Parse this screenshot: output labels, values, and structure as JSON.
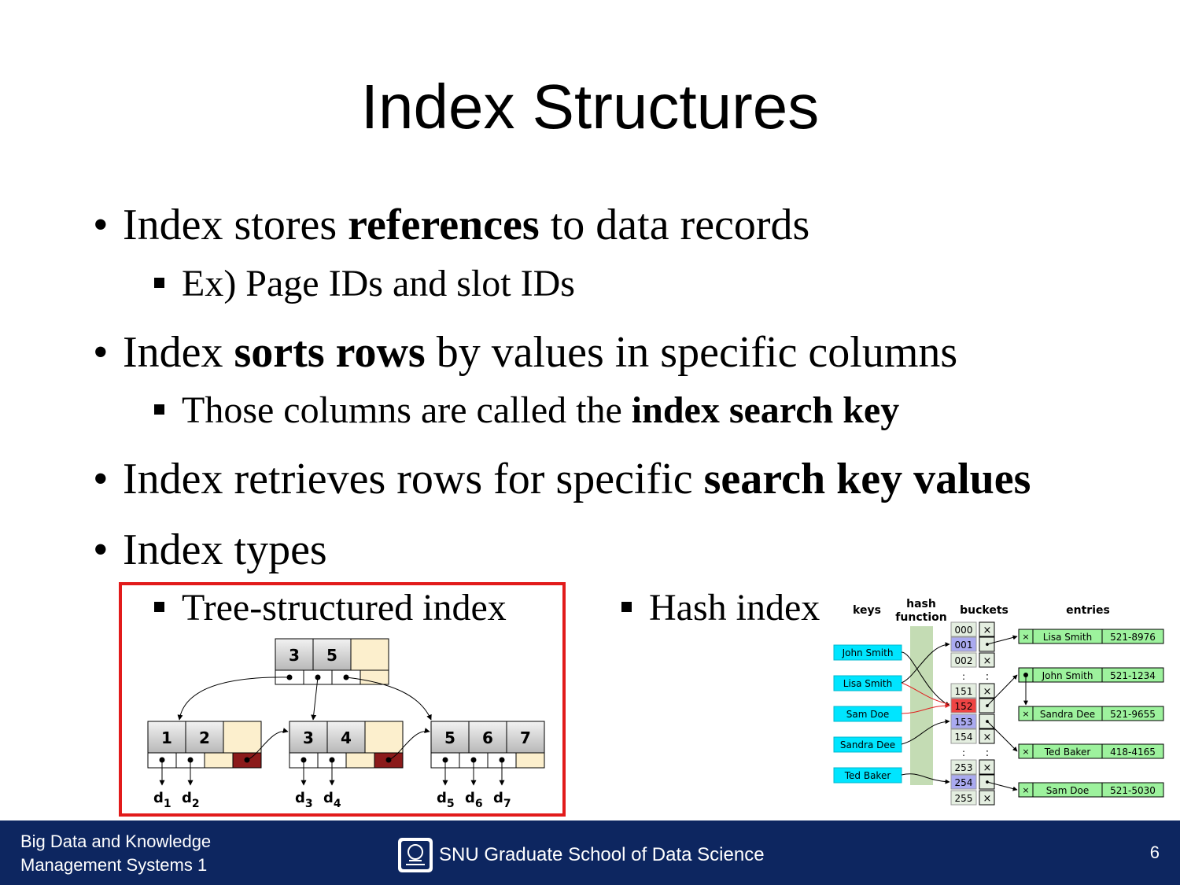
{
  "slide": {
    "title": "Index Structures",
    "bullets": [
      {
        "pre": "Index stores ",
        "bold": "references",
        "post": " to data records"
      },
      {
        "pre": "Index ",
        "bold": "sorts rows",
        "post": " by values in specific columns"
      },
      {
        "pre": "Index retrieves rows for specific ",
        "bold": "search key values",
        "post": ""
      },
      {
        "pre": "Index types",
        "bold": "",
        "post": ""
      }
    ],
    "subbullets": [
      {
        "pre": "Ex) Page IDs and slot IDs",
        "bold": ""
      },
      {
        "pre": "Those columns are called the ",
        "bold": "index search key"
      }
    ],
    "bullet_char": "•",
    "tree_label": "Tree-structured index",
    "hash_label": "Hash index"
  },
  "tree": {
    "root_keys": [
      "3",
      "5"
    ],
    "leaf1_keys": [
      "1",
      "2"
    ],
    "leaf2_keys": [
      "3",
      "4"
    ],
    "leaf3_keys": [
      "5",
      "6",
      "7"
    ],
    "refs": [
      {
        "d": "d",
        "sub": "1"
      },
      {
        "d": "d",
        "sub": "2"
      },
      {
        "d": "d",
        "sub": "3"
      },
      {
        "d": "d",
        "sub": "4"
      },
      {
        "d": "d",
        "sub": "5"
      },
      {
        "d": "d",
        "sub": "6"
      },
      {
        "d": "d",
        "sub": "7"
      }
    ],
    "colors": {
      "key_fill": "#d8d8d8",
      "empty_fill": "#fcefcd",
      "pointer_fill": "#8b1a1a"
    }
  },
  "hash": {
    "headers": {
      "keys": "keys",
      "hash1": "hash",
      "hash2": "function",
      "buckets": "buckets",
      "entries": "entries"
    },
    "keys": [
      "John Smith",
      "Lisa Smith",
      "Sam Doe",
      "Sandra Dee",
      "Ted Baker"
    ],
    "buckets": [
      "000",
      "001",
      "002",
      ":",
      "151",
      "152",
      "153",
      "154",
      ":",
      "253",
      "254",
      "255"
    ],
    "bucket_marks": [
      "×",
      "•",
      "×",
      ":",
      "×",
      "•",
      "•",
      "×",
      ":",
      "×",
      "•",
      "×"
    ],
    "entries": [
      {
        "name": "Lisa Smith",
        "phone": "521-8976"
      },
      {
        "name": "John Smith",
        "phone": "521-1234"
      },
      {
        "name": "Sandra Dee",
        "phone": "521-9655"
      },
      {
        "name": "Ted Baker",
        "phone": "418-4165"
      },
      {
        "name": "Sam Doe",
        "phone": "521-5030"
      }
    ],
    "colors": {
      "key_fill": "#00e5ff",
      "hash_fill": "#c4dcb4",
      "bucket_fill": "#e4eee0",
      "highlight_fill": "#aaaaf0",
      "collision_fill": "#ee4444",
      "entry_fill": "#9df29d"
    }
  },
  "footer": {
    "left_line1": "Big Data and Knowledge",
    "left_line2": "Management Systems 1",
    "center": "SNU Graduate School of Data Science",
    "page": "6"
  }
}
